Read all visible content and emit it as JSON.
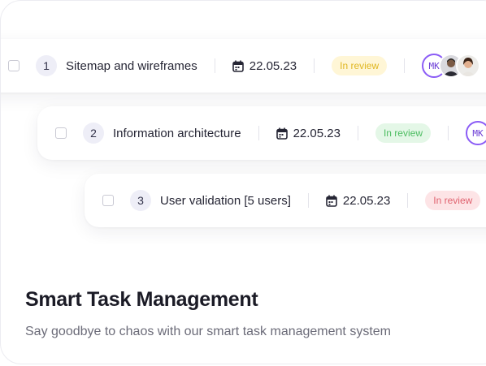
{
  "tasks": [
    {
      "number": "1",
      "title": "Sitemap and wireframes",
      "date": "22.05.23",
      "status": "In review",
      "status_color": "#e0b722"
    },
    {
      "number": "2",
      "title": "Information architecture",
      "date": "22.05.23",
      "status": "In review",
      "status_color": "#4cbd61"
    },
    {
      "number": "3",
      "title": "User validation [5 users]",
      "date": "22.05.23",
      "status": "In review",
      "status_color": "#e0626f"
    }
  ],
  "assignees": {
    "initials": "MK",
    "accent": "#8b5cf6"
  },
  "feature": {
    "heading": "Smart Task Management",
    "description": "Say goodbye to chaos with our smart task management system"
  }
}
